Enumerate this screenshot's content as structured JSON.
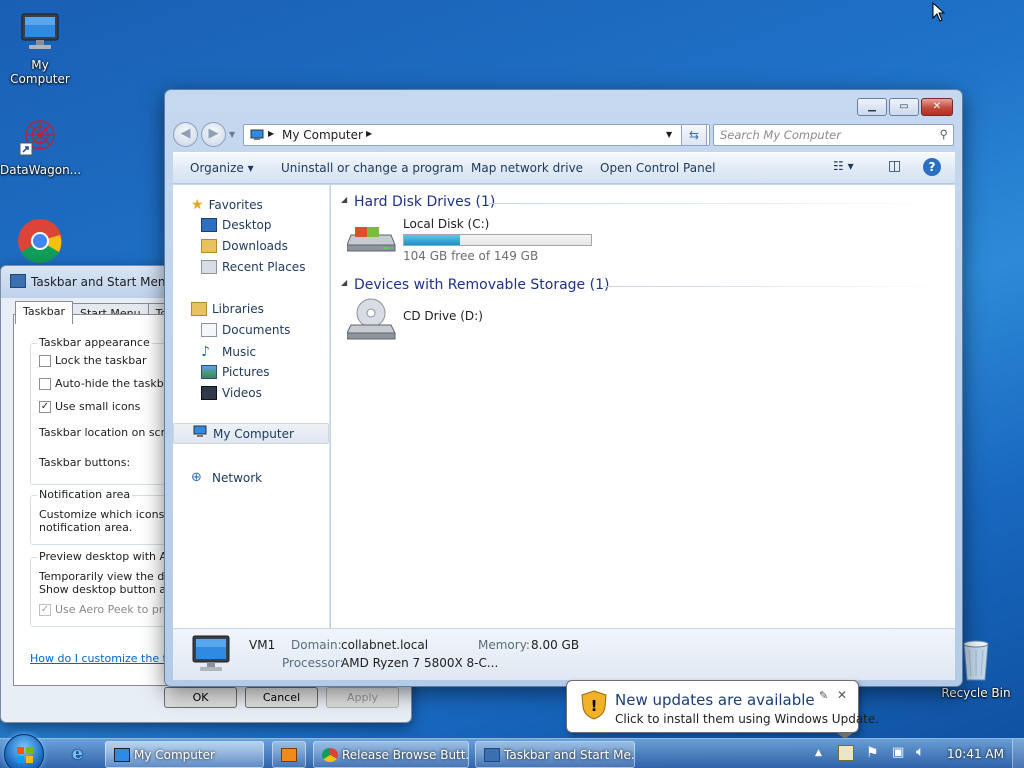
{
  "desktop": {
    "icons": {
      "my_computer": "My Computer",
      "datawagon": "DataWagon...",
      "recycle_bin": "Recycle Bin"
    }
  },
  "taskbar_dialog": {
    "title": "Taskbar and Start Menu P",
    "tabs": [
      "Taskbar",
      "Start Menu",
      "Toolb"
    ],
    "appearance_group": "Taskbar appearance",
    "lock_taskbar": "Lock the taskbar",
    "autohide": "Auto-hide the taskbar",
    "small_icons": "Use small icons",
    "location": "Taskbar location on screen",
    "buttons": "Taskbar buttons:",
    "notification_group": "Notification area",
    "notification_text_1": "Customize which icons and",
    "notification_text_2": "notification area.",
    "preview_group": "Preview desktop with Aero",
    "preview_text_1": "Temporarily view the desk",
    "preview_text_2": "Show desktop button at e",
    "use_aero_peek": "Use Aero Peek to previ",
    "help_link": "How do I customize the task",
    "ok": "OK",
    "cancel": "Cancel",
    "apply": "Apply"
  },
  "explorer": {
    "address": "My Computer",
    "search_placeholder": "Search My Computer",
    "commands": {
      "organize": "Organize",
      "uninstall": "Uninstall or change a program",
      "map_drive": "Map network drive",
      "control_panel": "Open Control Panel"
    },
    "nav": {
      "favorites": "Favorites",
      "desktop": "Desktop",
      "downloads": "Downloads",
      "recent_places": "Recent Places",
      "libraries": "Libraries",
      "documents": "Documents",
      "music": "Music",
      "pictures": "Pictures",
      "videos": "Videos",
      "my_computer": "My Computer",
      "network": "Network"
    },
    "sections": {
      "hard_disks": "Hard Disk Drives (1)",
      "removable": "Devices with Removable Storage (1)"
    },
    "drives": {
      "local_disk_name": "Local Disk (C:)",
      "local_disk_free": "104 GB free of 149 GB",
      "local_disk_used_fraction": 0.3,
      "cd_drive_name": "CD Drive (D:)"
    },
    "details": {
      "computer_name": "VM1",
      "domain_label": "Domain:",
      "domain_value": "collabnet.local",
      "memory_label": "Memory:",
      "memory_value": "8.00 GB",
      "processor_label": "Processor:",
      "processor_value": "AMD Ryzen 7 5800X 8-C..."
    }
  },
  "taskbar": {
    "buttons": {
      "my_computer": "My Computer",
      "browser": "Release Browse Butt...",
      "taskbar_dialog": "Taskbar and Start Me..."
    },
    "clock": "10:41 AM"
  },
  "balloon": {
    "title": "New updates are available",
    "text": "Click to install them using Windows Update."
  }
}
